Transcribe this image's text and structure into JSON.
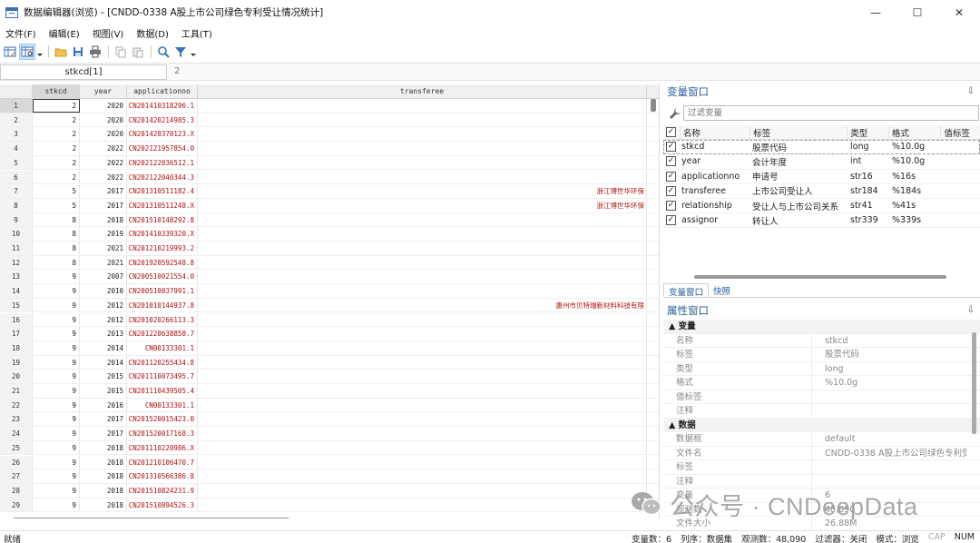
{
  "window": {
    "title": "数据编辑器(浏览) - [CNDD-0338 A股上市公司绿色专利受让情况统计]",
    "minimize": "—",
    "maximize": "☐",
    "close": "✕"
  },
  "menu": [
    "文件(F)",
    "编辑(E)",
    "视图(V)",
    "数据(D)",
    "工具(T)"
  ],
  "cellbar": {
    "name": "stkcd[1]",
    "value": "2"
  },
  "grid": {
    "headers": [
      "stkcd",
      "year",
      "applicationno",
      "transferee"
    ],
    "rows": [
      {
        "i": "1",
        "stkcd": "2",
        "year": "2020",
        "app": "CN201410318296.1",
        "tr": ""
      },
      {
        "i": "2",
        "stkcd": "2",
        "year": "2020",
        "app": "CN201420214985.3",
        "tr": ""
      },
      {
        "i": "3",
        "stkcd": "2",
        "year": "2020",
        "app": "CN201420370123.X",
        "tr": ""
      },
      {
        "i": "4",
        "stkcd": "2",
        "year": "2022",
        "app": "CN202121957854.0",
        "tr": ""
      },
      {
        "i": "5",
        "stkcd": "2",
        "year": "2022",
        "app": "CN202122036512.1",
        "tr": ""
      },
      {
        "i": "6",
        "stkcd": "2",
        "year": "2022",
        "app": "CN202122040344.3",
        "tr": ""
      },
      {
        "i": "7",
        "stkcd": "5",
        "year": "2017",
        "app": "CN201310511182.4",
        "tr": "浙江博世华环保"
      },
      {
        "i": "8",
        "stkcd": "5",
        "year": "2017",
        "app": "CN201310511248.X",
        "tr": "浙江博世华环保"
      },
      {
        "i": "9",
        "stkcd": "8",
        "year": "2018",
        "app": "CN201510148292.8",
        "tr": ""
      },
      {
        "i": "10",
        "stkcd": "8",
        "year": "2019",
        "app": "CN201410339320.X",
        "tr": ""
      },
      {
        "i": "11",
        "stkcd": "8",
        "year": "2021",
        "app": "CN201210219993.2",
        "tr": ""
      },
      {
        "i": "12",
        "stkcd": "8",
        "year": "2021",
        "app": "CN201920592548.8",
        "tr": ""
      },
      {
        "i": "13",
        "stkcd": "9",
        "year": "2007",
        "app": "CN200510021554.0",
        "tr": ""
      },
      {
        "i": "14",
        "stkcd": "9",
        "year": "2010",
        "app": "CN200510037991.1",
        "tr": ""
      },
      {
        "i": "15",
        "stkcd": "9",
        "year": "2012",
        "app": "CN201010144937.8",
        "tr": "惠州市贝特瑞新材料科技有限"
      },
      {
        "i": "16",
        "stkcd": "9",
        "year": "2012",
        "app": "CN201020266113.3",
        "tr": ""
      },
      {
        "i": "17",
        "stkcd": "9",
        "year": "2013",
        "app": "CN201220638858.7",
        "tr": ""
      },
      {
        "i": "18",
        "stkcd": "9",
        "year": "2014",
        "app": "CN00133301.1",
        "tr": ""
      },
      {
        "i": "19",
        "stkcd": "9",
        "year": "2014",
        "app": "CN201120255434.8",
        "tr": ""
      },
      {
        "i": "20",
        "stkcd": "9",
        "year": "2015",
        "app": "CN201110073495.7",
        "tr": ""
      },
      {
        "i": "21",
        "stkcd": "9",
        "year": "2015",
        "app": "CN201110439505.4",
        "tr": ""
      },
      {
        "i": "22",
        "stkcd": "9",
        "year": "2016",
        "app": "CN00133301.1",
        "tr": ""
      },
      {
        "i": "23",
        "stkcd": "9",
        "year": "2017",
        "app": "CN201520015423.0",
        "tr": ""
      },
      {
        "i": "24",
        "stkcd": "9",
        "year": "2017",
        "app": "CN201520017168.3",
        "tr": ""
      },
      {
        "i": "25",
        "stkcd": "9",
        "year": "2018",
        "app": "CN201110220986.X",
        "tr": ""
      },
      {
        "i": "26",
        "stkcd": "9",
        "year": "2018",
        "app": "CN201210106470.7",
        "tr": ""
      },
      {
        "i": "27",
        "stkcd": "9",
        "year": "2018",
        "app": "CN201310566386.8",
        "tr": ""
      },
      {
        "i": "28",
        "stkcd": "9",
        "year": "2018",
        "app": "CN201510824231.9",
        "tr": ""
      },
      {
        "i": "29",
        "stkcd": "9",
        "year": "2018",
        "app": "CN201510894526.3",
        "tr": ""
      }
    ]
  },
  "variables": {
    "title": "变量窗口",
    "pin": "⇩",
    "filter_placeholder": "过滤变量",
    "headers": {
      "name": "名称",
      "label": "标签",
      "type": "类型",
      "format": "格式",
      "value_label": "值标签"
    },
    "items": [
      {
        "name": "stkcd",
        "label": "股票代码",
        "type": "long",
        "format": "%10.0g"
      },
      {
        "name": "year",
        "label": "会计年度",
        "type": "int",
        "format": "%10.0g"
      },
      {
        "name": "applicationno",
        "label": "申请号",
        "type": "str16",
        "format": "%16s"
      },
      {
        "name": "transferee",
        "label": "上市公司受让人",
        "type": "str184",
        "format": "%184s"
      },
      {
        "name": "relationship",
        "label": "受让人与上市公司关系",
        "type": "str41",
        "format": "%41s"
      },
      {
        "name": "assignor",
        "label": "转让人",
        "type": "str339",
        "format": "%339s"
      }
    ]
  },
  "tabs": [
    "变量窗口",
    "快照"
  ],
  "properties": {
    "title": "属性窗口",
    "sections": [
      {
        "title": "▲ 变量",
        "rows": [
          {
            "k": "名称",
            "v": "stkcd"
          },
          {
            "k": "标签",
            "v": "股票代码"
          },
          {
            "k": "类型",
            "v": "long"
          },
          {
            "k": "格式",
            "v": "%10.0g"
          },
          {
            "k": "值标签",
            "v": ""
          },
          {
            "k": "注释",
            "v": ""
          }
        ]
      },
      {
        "title": "▲ 数据",
        "rows": [
          {
            "k": "数据框",
            "v": "default"
          },
          {
            "k": "文件名",
            "v": "CNDD-0338 A股上市公司绿色专利受让"
          },
          {
            "k": "标签",
            "v": ""
          },
          {
            "k": "注释",
            "v": ""
          },
          {
            "k": "变量",
            "v": "6"
          },
          {
            "k": "观测数",
            "v": "48,090"
          },
          {
            "k": "文件大小",
            "v": "26.88M"
          }
        ]
      }
    ]
  },
  "watermark": "公众号 · CNDeepData",
  "status": {
    "left": "就绪",
    "vars": "变量数：6",
    "order": "列序：数据集",
    "obs": "观测数：48,090",
    "filter": "过滤器：关闭",
    "mode": "模式：浏览",
    "cap": "CAP",
    "num": "NUM"
  }
}
